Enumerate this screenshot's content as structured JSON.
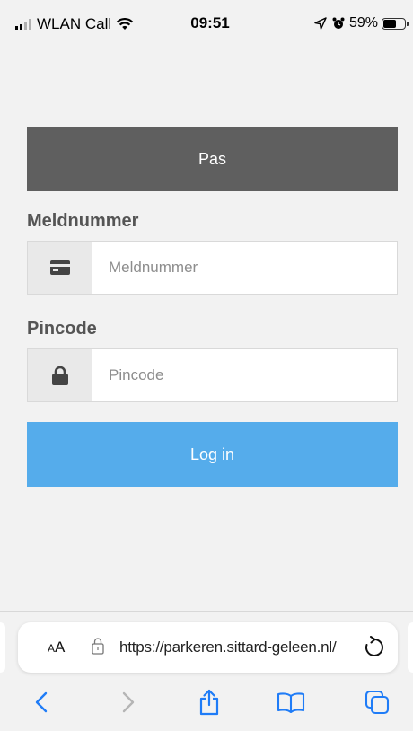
{
  "status_bar": {
    "carrier": "WLAN Call",
    "time": "09:51",
    "battery": "59%",
    "battery_level": 0.59
  },
  "page": {
    "header": "Pas",
    "meldnummer_label": "Meldnummer",
    "meldnummer_placeholder": "Meldnummer",
    "meldnummer_value": "",
    "pincode_label": "Pincode",
    "pincode_placeholder": "Pincode",
    "pincode_value": "",
    "login_label": "Log in",
    "accent_color": "#55aceb"
  },
  "browser": {
    "text_size_button": "AA",
    "url": "https://parkeren.sittard-geleen.nl/",
    "icons": [
      "lock-icon",
      "reload-icon",
      "back-icon",
      "forward-icon",
      "share-icon",
      "bookmarks-icon",
      "tabs-icon"
    ]
  }
}
